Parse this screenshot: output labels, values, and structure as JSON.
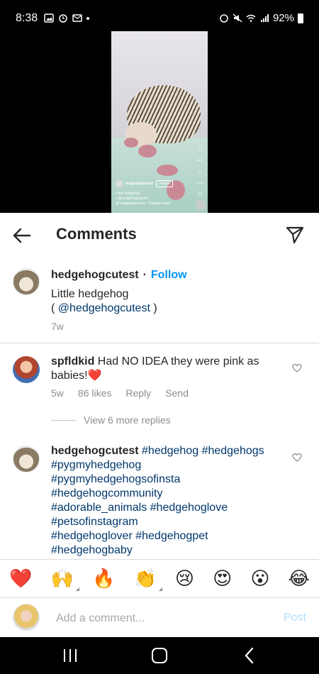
{
  "status_bar": {
    "time": "8:38",
    "battery": "92%"
  },
  "video": {
    "username": "hedgehogcutest",
    "follow_label": "Follow",
    "caption": "Little hedgehog",
    "caption_mention": "( @hedgehogcutest )",
    "audio": "@ hedgehogcutest · Original audio",
    "likes": "667K",
    "comments": "1,211"
  },
  "header": {
    "title": "Comments",
    "back_icon": "arrow-left-icon",
    "share_icon": "paper-plane-icon"
  },
  "caption_post": {
    "username": "hedgehogcutest",
    "follow_label": "Follow",
    "text_line1": "Little hedgehog",
    "text_open": "( ",
    "mention": "@hedgehogcutest",
    "text_close": " )",
    "age": "7w"
  },
  "comments": [
    {
      "username": "spfldkid",
      "text": "Had NO IDEA they were pink as babies!❤️",
      "age": "5w",
      "likes": "86 likes",
      "reply_label": "Reply",
      "send_label": "Send"
    },
    {
      "username": "hedgehogcutest",
      "tags": [
        "#hedgehog",
        "#hedgehogs",
        "#pygmyhedgehog",
        "#pygmyhedgehogsofinsta",
        "#hedgehogcommunity",
        "#adorable_animals",
        "#hedgehoglove",
        "#petsofinstagram",
        "#hedgehoglover",
        "#hedgehogpet",
        "#hedgehogbaby"
      ]
    }
  ],
  "view_replies_label": "View 6 more replies",
  "emoji_bar": [
    {
      "char": "❤️",
      "name": "red-heart-emoji"
    },
    {
      "char": "🙌",
      "name": "raising-hands-emoji"
    },
    {
      "char": "🔥",
      "name": "fire-emoji"
    },
    {
      "char": "👏",
      "name": "clapping-hands-emoji"
    },
    {
      "char": "😢",
      "name": "crying-face-emoji"
    },
    {
      "char": "😍",
      "name": "heart-eyes-emoji"
    },
    {
      "char": "😮",
      "name": "surprised-face-emoji"
    },
    {
      "char": "😂",
      "name": "tears-of-joy-emoji"
    }
  ],
  "input": {
    "placeholder": "Add a comment...",
    "post_label": "Post"
  },
  "colors": {
    "link_blue": "#0095f6",
    "tag_blue": "#00376b",
    "muted": "#8e8e8e",
    "post_disabled": "#b2dffc"
  }
}
